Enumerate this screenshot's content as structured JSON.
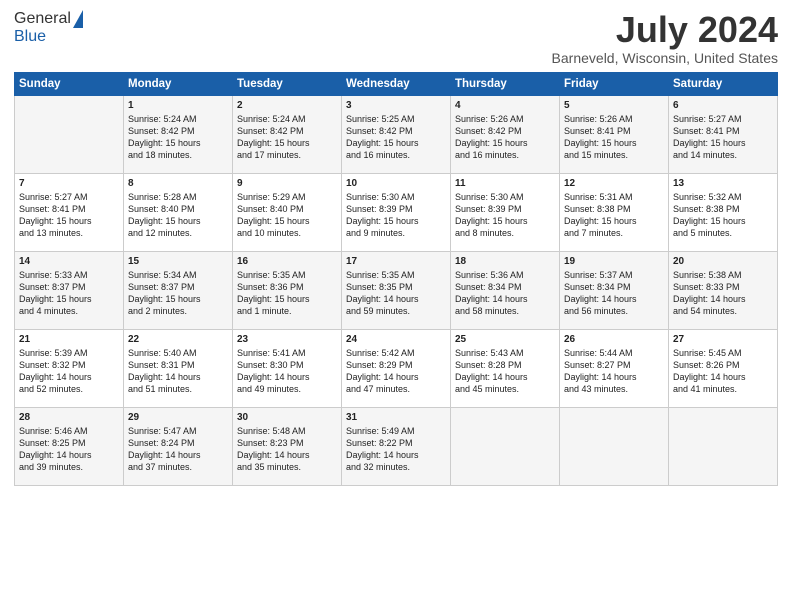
{
  "header": {
    "logo_general": "General",
    "logo_blue": "Blue",
    "month": "July 2024",
    "location": "Barneveld, Wisconsin, United States"
  },
  "days_of_week": [
    "Sunday",
    "Monday",
    "Tuesday",
    "Wednesday",
    "Thursday",
    "Friday",
    "Saturday"
  ],
  "weeks": [
    [
      {
        "day": "",
        "text": ""
      },
      {
        "day": "1",
        "text": "Sunrise: 5:24 AM\nSunset: 8:42 PM\nDaylight: 15 hours\nand 18 minutes."
      },
      {
        "day": "2",
        "text": "Sunrise: 5:24 AM\nSunset: 8:42 PM\nDaylight: 15 hours\nand 17 minutes."
      },
      {
        "day": "3",
        "text": "Sunrise: 5:25 AM\nSunset: 8:42 PM\nDaylight: 15 hours\nand 16 minutes."
      },
      {
        "day": "4",
        "text": "Sunrise: 5:26 AM\nSunset: 8:42 PM\nDaylight: 15 hours\nand 16 minutes."
      },
      {
        "day": "5",
        "text": "Sunrise: 5:26 AM\nSunset: 8:41 PM\nDaylight: 15 hours\nand 15 minutes."
      },
      {
        "day": "6",
        "text": "Sunrise: 5:27 AM\nSunset: 8:41 PM\nDaylight: 15 hours\nand 14 minutes."
      }
    ],
    [
      {
        "day": "7",
        "text": "Sunrise: 5:27 AM\nSunset: 8:41 PM\nDaylight: 15 hours\nand 13 minutes."
      },
      {
        "day": "8",
        "text": "Sunrise: 5:28 AM\nSunset: 8:40 PM\nDaylight: 15 hours\nand 12 minutes."
      },
      {
        "day": "9",
        "text": "Sunrise: 5:29 AM\nSunset: 8:40 PM\nDaylight: 15 hours\nand 10 minutes."
      },
      {
        "day": "10",
        "text": "Sunrise: 5:30 AM\nSunset: 8:39 PM\nDaylight: 15 hours\nand 9 minutes."
      },
      {
        "day": "11",
        "text": "Sunrise: 5:30 AM\nSunset: 8:39 PM\nDaylight: 15 hours\nand 8 minutes."
      },
      {
        "day": "12",
        "text": "Sunrise: 5:31 AM\nSunset: 8:38 PM\nDaylight: 15 hours\nand 7 minutes."
      },
      {
        "day": "13",
        "text": "Sunrise: 5:32 AM\nSunset: 8:38 PM\nDaylight: 15 hours\nand 5 minutes."
      }
    ],
    [
      {
        "day": "14",
        "text": "Sunrise: 5:33 AM\nSunset: 8:37 PM\nDaylight: 15 hours\nand 4 minutes."
      },
      {
        "day": "15",
        "text": "Sunrise: 5:34 AM\nSunset: 8:37 PM\nDaylight: 15 hours\nand 2 minutes."
      },
      {
        "day": "16",
        "text": "Sunrise: 5:35 AM\nSunset: 8:36 PM\nDaylight: 15 hours\nand 1 minute."
      },
      {
        "day": "17",
        "text": "Sunrise: 5:35 AM\nSunset: 8:35 PM\nDaylight: 14 hours\nand 59 minutes."
      },
      {
        "day": "18",
        "text": "Sunrise: 5:36 AM\nSunset: 8:34 PM\nDaylight: 14 hours\nand 58 minutes."
      },
      {
        "day": "19",
        "text": "Sunrise: 5:37 AM\nSunset: 8:34 PM\nDaylight: 14 hours\nand 56 minutes."
      },
      {
        "day": "20",
        "text": "Sunrise: 5:38 AM\nSunset: 8:33 PM\nDaylight: 14 hours\nand 54 minutes."
      }
    ],
    [
      {
        "day": "21",
        "text": "Sunrise: 5:39 AM\nSunset: 8:32 PM\nDaylight: 14 hours\nand 52 minutes."
      },
      {
        "day": "22",
        "text": "Sunrise: 5:40 AM\nSunset: 8:31 PM\nDaylight: 14 hours\nand 51 minutes."
      },
      {
        "day": "23",
        "text": "Sunrise: 5:41 AM\nSunset: 8:30 PM\nDaylight: 14 hours\nand 49 minutes."
      },
      {
        "day": "24",
        "text": "Sunrise: 5:42 AM\nSunset: 8:29 PM\nDaylight: 14 hours\nand 47 minutes."
      },
      {
        "day": "25",
        "text": "Sunrise: 5:43 AM\nSunset: 8:28 PM\nDaylight: 14 hours\nand 45 minutes."
      },
      {
        "day": "26",
        "text": "Sunrise: 5:44 AM\nSunset: 8:27 PM\nDaylight: 14 hours\nand 43 minutes."
      },
      {
        "day": "27",
        "text": "Sunrise: 5:45 AM\nSunset: 8:26 PM\nDaylight: 14 hours\nand 41 minutes."
      }
    ],
    [
      {
        "day": "28",
        "text": "Sunrise: 5:46 AM\nSunset: 8:25 PM\nDaylight: 14 hours\nand 39 minutes."
      },
      {
        "day": "29",
        "text": "Sunrise: 5:47 AM\nSunset: 8:24 PM\nDaylight: 14 hours\nand 37 minutes."
      },
      {
        "day": "30",
        "text": "Sunrise: 5:48 AM\nSunset: 8:23 PM\nDaylight: 14 hours\nand 35 minutes."
      },
      {
        "day": "31",
        "text": "Sunrise: 5:49 AM\nSunset: 8:22 PM\nDaylight: 14 hours\nand 32 minutes."
      },
      {
        "day": "",
        "text": ""
      },
      {
        "day": "",
        "text": ""
      },
      {
        "day": "",
        "text": ""
      }
    ]
  ]
}
